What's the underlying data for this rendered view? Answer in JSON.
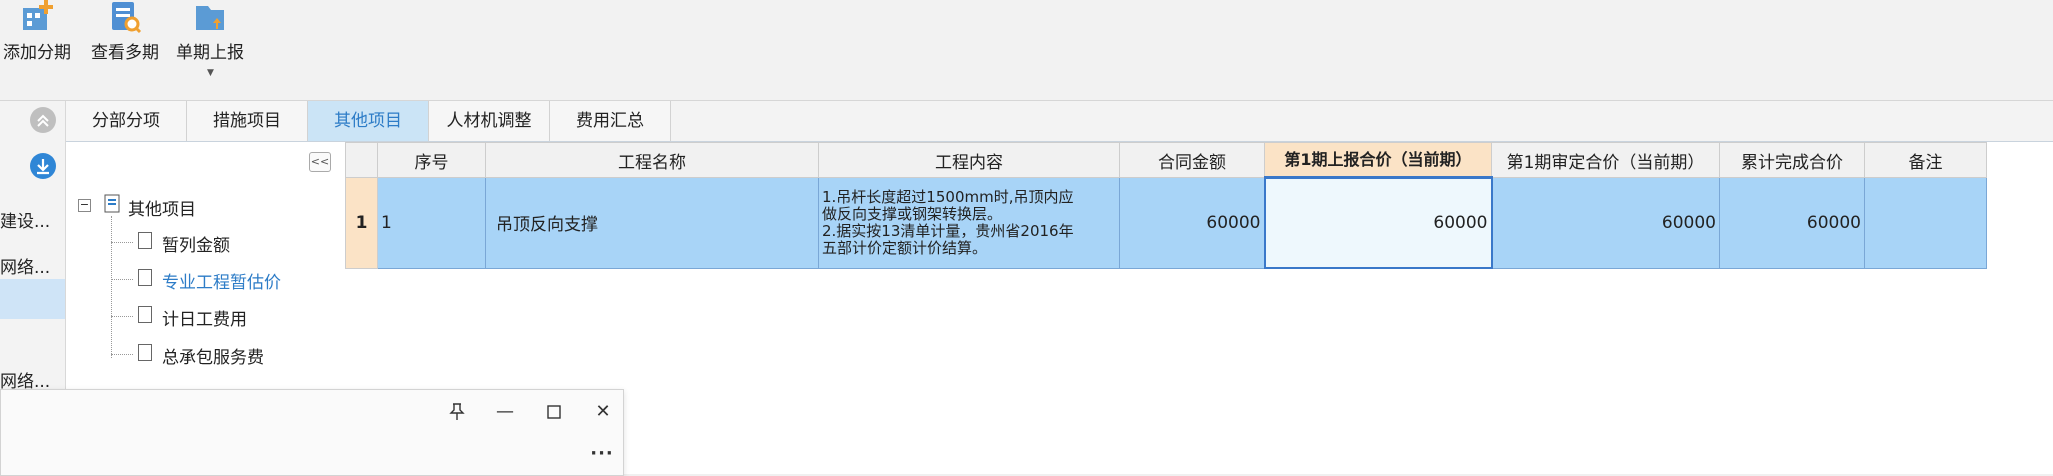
{
  "toolbar": {
    "add_period": "添加分期",
    "view_multi_period": "查看多期",
    "single_period_report": "单期上报"
  },
  "left_strip": {
    "item_1": "建设...",
    "item_2": "网络...",
    "item_3": "网络..."
  },
  "tabs": [
    {
      "label": "分部分项"
    },
    {
      "label": "措施项目"
    },
    {
      "label": "其他项目"
    },
    {
      "label": "人材机调整"
    },
    {
      "label": "费用汇总"
    }
  ],
  "tree": {
    "collapse_label": "<<",
    "root": "其他项目",
    "children": [
      "暂列金额",
      "专业工程暂估价",
      "计日工费用",
      "总承包服务费"
    ]
  },
  "grid": {
    "columns": [
      "序号",
      "工程名称",
      "工程内容",
      "合同金额",
      "第1期上报合价（当前期）",
      "第1期审定合价（当前期）",
      "累计完成合价",
      "备注"
    ],
    "rows": [
      {
        "row_number": "1",
        "index": "1",
        "name": "吊顶反向支撑",
        "content_line1": "1.吊杆长度超过1500mm时,吊顶内应",
        "content_line2": "做反向支撑或钢架转换层。",
        "content_line3": "2.据实按13清单计量，贵州省2016年",
        "content_line4": "五部计价定额计价结算。",
        "contract_amount": "60000",
        "reported_amount": "60000",
        "approved_amount": "60000",
        "cumulative_amount": "60000",
        "remark": ""
      }
    ]
  },
  "colors": {
    "accent": "#2d7cc7",
    "selected_row": "#a8d4f7",
    "active_tab": "#cbe4f6",
    "header_highlight": "#fbe3c6"
  },
  "icons": [
    "add-period-icon",
    "view-multi-period-icon",
    "report-icon",
    "collapse-circle-icon",
    "download-circle-icon",
    "tree-root-icon",
    "document-icon",
    "pin-icon",
    "minimize-icon",
    "maximize-icon",
    "close-icon",
    "more-icon"
  ]
}
